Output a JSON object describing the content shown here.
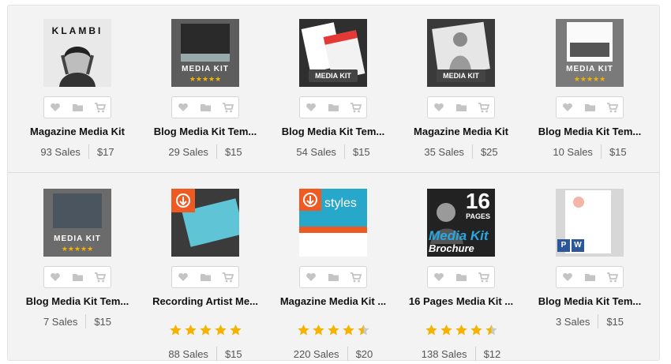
{
  "products": [
    {
      "title": "Magazine Media Kit",
      "sales": "93 Sales",
      "price": "$17",
      "thumb_text": "KLAMBI"
    },
    {
      "title": "Blog Media Kit Tem...",
      "sales": "29 Sales",
      "price": "$15",
      "thumb_text": "MEDIA KIT"
    },
    {
      "title": "Blog Media Kit Tem...",
      "sales": "54 Sales",
      "price": "$15",
      "thumb_text": "MEDIA KIT"
    },
    {
      "title": "Magazine Media Kit",
      "sales": "35 Sales",
      "price": "$25",
      "thumb_text": "MEDIA KIT"
    },
    {
      "title": "Blog Media Kit Tem...",
      "sales": "10 Sales",
      "price": "$15",
      "thumb_text": "MEDIA KIT"
    },
    {
      "title": "Blog Media Kit Tem...",
      "sales": "7 Sales",
      "price": "$15",
      "thumb_text": "MEDIA KIT"
    },
    {
      "title": "Recording Artist Me...",
      "sales": "88 Sales",
      "price": "$15",
      "rating": 5
    },
    {
      "title": "Magazine Media Kit ...",
      "sales": "220 Sales",
      "price": "$20",
      "rating": 4.5,
      "thumb_text": "styles"
    },
    {
      "title": "16 Pages Media Kit ...",
      "sales": "138 Sales",
      "price": "$12",
      "rating": 4.5,
      "thumb_text": "Media Kit",
      "thumb_text2": "Brochure",
      "thumb_text3": "16",
      "thumb_text4": "PAGES"
    },
    {
      "title": "Blog Media Kit Tem...",
      "sales": "3 Sales",
      "price": "$15"
    }
  ],
  "icons": [
    "heart-icon",
    "folder-icon",
    "cart-icon"
  ],
  "colors": {
    "star": "#f5b301",
    "star_empty": "#c9c9c9",
    "panel": "#f3f3f3"
  }
}
